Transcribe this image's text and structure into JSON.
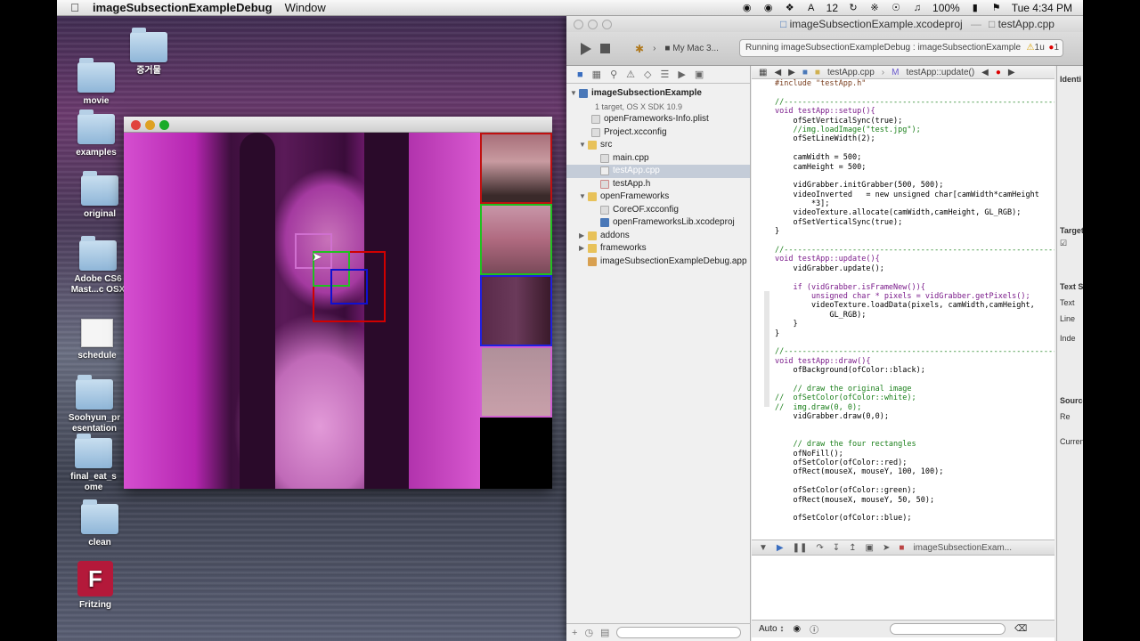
{
  "menubar": {
    "app_name": "imageSubsectionExampleDebug",
    "menu_window": "Window",
    "battery": "100%",
    "clock": "Tue 4:34 PM",
    "status_num": "12"
  },
  "desktop": {
    "items": [
      {
        "label": "증거물"
      },
      {
        "label": "movie"
      },
      {
        "label": "examples"
      },
      {
        "label": "original"
      },
      {
        "label": "Adobe CS6 Mast...c OSX"
      },
      {
        "label": "schedule"
      },
      {
        "label": "Soohyun_presentation"
      },
      {
        "label": "final_eat_some"
      },
      {
        "label": "clean"
      },
      {
        "label": "Fritzing"
      }
    ]
  },
  "xcode": {
    "title_project": "imageSubsectionExample.xcodeproj",
    "title_file": "testApp.cpp",
    "scheme": "My Mac 3...",
    "activity": "Running imageSubsectionExampleDebug : imageSubsectionExample Debu",
    "warn_count": "1",
    "error_count": "1",
    "navigator": {
      "items": [
        {
          "label": "imageSubsectionExample",
          "indent": 0
        },
        {
          "label": "1 target, OS X SDK 10.9",
          "indent": 0
        },
        {
          "label": "openFrameworks-Info.plist",
          "indent": 1
        },
        {
          "label": "Project.xcconfig",
          "indent": 1
        },
        {
          "label": "src",
          "indent": 1
        },
        {
          "label": "main.cpp",
          "indent": 2
        },
        {
          "label": "testApp.cpp",
          "indent": 2
        },
        {
          "label": "testApp.h",
          "indent": 2
        },
        {
          "label": "openFrameworks",
          "indent": 1
        },
        {
          "label": "CoreOF.xcconfig",
          "indent": 2
        },
        {
          "label": "openFrameworksLib.xcodeproj",
          "indent": 2
        },
        {
          "label": "addons",
          "indent": 1
        },
        {
          "label": "frameworks",
          "indent": 1
        },
        {
          "label": "imageSubsectionExampleDebug.app",
          "indent": 1
        }
      ]
    },
    "jumpbar": {
      "file": "testApp.cpp",
      "symbol": "testApp::update()"
    },
    "code_lines": [
      "#include \"testApp.h\"",
      "",
      "//--------------------------------------------------------------",
      "void testApp::setup(){",
      "    ofSetVerticalSync(true);",
      "    //img.loadImage(\"test.jpg\");",
      "    ofSetLineWidth(2);",
      "",
      "    camWidth = 500;",
      "    camHeight = 500;",
      "",
      "    vidGrabber.initGrabber(500, 500);",
      "    videoInverted   = new unsigned char[camWidth*camHeight",
      "        *3];",
      "    videoTexture.allocate(camWidth,camHeight, GL_RGB);",
      "    ofSetVerticalSync(true);",
      "}",
      "",
      "//--------------------------------------------------------------",
      "void testApp::update(){",
      "    vidGrabber.update();",
      "",
      "    if (vidGrabber.isFrameNew()){",
      "        unsigned char * pixels = vidGrabber.getPixels();",
      "        videoTexture.loadData(pixels, camWidth,camHeight,",
      "            GL_RGB);",
      "    }",
      "}",
      "",
      "//--------------------------------------------------------------",
      "void testApp::draw(){",
      "    ofBackground(ofColor::black);",
      "",
      "    // draw the original image",
      "//  ofSetColor(ofColor::white);",
      "//  img.draw(0, 0);",
      "    vidGrabber.draw(0,0);",
      "",
      "",
      "    // draw the four rectangles",
      "    ofNoFill();",
      "    ofSetColor(ofColor::red);",
      "    ofRect(mouseX, mouseY, 100, 100);",
      "",
      "    ofSetColor(ofColor::green);",
      "    ofRect(mouseX, mouseY, 50, 50);",
      "",
      "    ofSetColor(ofColor::blue);"
    ],
    "debug_target": "imageSubsectionExam...",
    "bottom_auto": "Auto ↕",
    "inspector": {
      "identity": "Identi",
      "target": "Target",
      "text_settings": "Text S",
      "text_enc": "Text",
      "line": "Line",
      "indent": "Inde",
      "source": "Source",
      "re": "Re",
      "current": "Curren"
    }
  }
}
